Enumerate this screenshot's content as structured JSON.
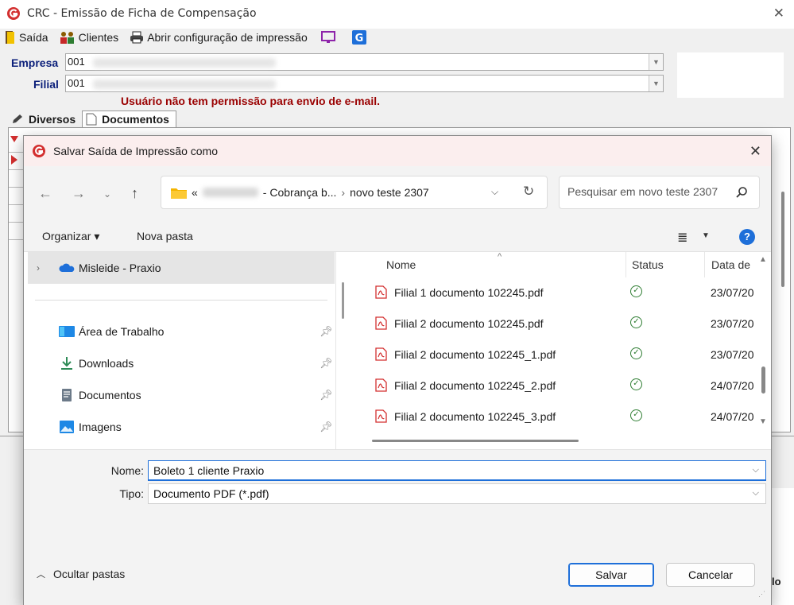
{
  "background_app": {
    "title": "CRC - Emissão de Ficha de Compensação",
    "toolbar": {
      "exit_label": "Saída",
      "clients_label": "Clientes",
      "print_config_label": "Abrir configuração de impressão"
    },
    "empresa_label": "Empresa",
    "empresa_value": "001",
    "filial_label": "Filial",
    "filial_value": "001",
    "warning": "Usuário não tem permissão para envio de e-mail.",
    "tabs": [
      "Diversos",
      "Documentos"
    ],
    "right_fragment": "lo"
  },
  "dialog": {
    "title": "Salvar Saída de Impressão como",
    "address": {
      "prefix": "«",
      "segment_1": "- Cobrança b...",
      "separator": "›",
      "segment_2": "novo teste 2307"
    },
    "search": {
      "placeholder": "Pesquisar em novo teste 2307"
    },
    "commands": {
      "organize": "Organizar ▾",
      "new_folder": "Nova pasta"
    },
    "nav_pane": {
      "onedrive": "Misleide - Praxio",
      "items": [
        {
          "label": "Área de Trabalho",
          "icon": "desktop-icon"
        },
        {
          "label": "Downloads",
          "icon": "download-icon"
        },
        {
          "label": "Documentos",
          "icon": "documents-icon"
        },
        {
          "label": "Imagens",
          "icon": "pictures-icon"
        }
      ]
    },
    "columns": {
      "name": "Nome",
      "status": "Status",
      "date": "Data de"
    },
    "files": [
      {
        "name": "Filial 1 documento 102245.pdf",
        "date": "23/07/20"
      },
      {
        "name": "Filial 2 documento 102245.pdf",
        "date": "23/07/20"
      },
      {
        "name": "Filial 2 documento 102245_1.pdf",
        "date": "23/07/20"
      },
      {
        "name": "Filial 2 documento 102245_2.pdf",
        "date": "24/07/20"
      },
      {
        "name": "Filial 2 documento 102245_3.pdf",
        "date": "24/07/20"
      }
    ],
    "filename_label": "Nome:",
    "filename_value": "Boleto 1 cliente Praxio",
    "type_label": "Tipo:",
    "type_value": "Documento PDF (*.pdf)",
    "hide_folders": "Ocultar pastas",
    "save_button": "Salvar",
    "cancel_button": "Cancelar"
  },
  "colors": {
    "accent": "#1e6fd9",
    "title_tint": "#fbeeee",
    "warning_text": "#9a0000",
    "label_blue": "#0b1f7a",
    "status_ok": "#2e7d32",
    "pdf_red": "#d32f2f"
  }
}
